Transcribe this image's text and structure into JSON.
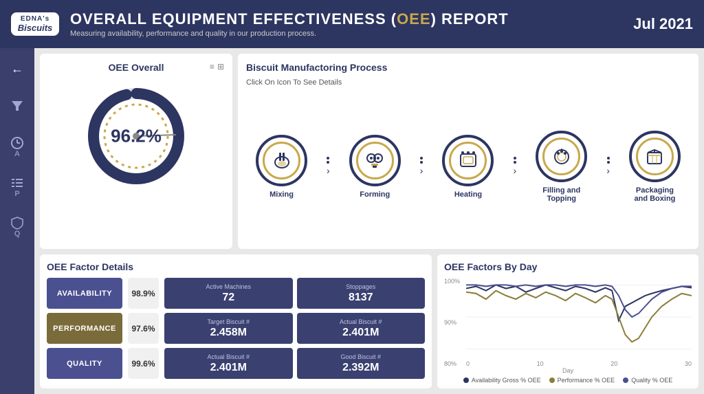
{
  "header": {
    "logo_edna": "EDNA's",
    "logo_biscuits": "Biscuits",
    "title_prefix": "OVERALL EQUIPMENT EFFECTIVENESS (",
    "title_oee": "OEE",
    "title_suffix": ") REPORT",
    "subtitle": "Measuring availability, performance and quality in our production process.",
    "date": "Jul 2021"
  },
  "sidebar": {
    "icons": [
      {
        "name": "back-icon",
        "symbol": "←",
        "label": ""
      },
      {
        "name": "filter-icon",
        "symbol": "▼",
        "label": ""
      },
      {
        "name": "clock-icon",
        "symbol": "⏱",
        "label": "A"
      },
      {
        "name": "list-icon",
        "symbol": "≡",
        "label": "P"
      },
      {
        "name": "shield-icon",
        "symbol": "🛡",
        "label": "Q"
      }
    ]
  },
  "oee_overall": {
    "title": "OEE Overall",
    "value": "96.2%",
    "donut_percent": 96.2,
    "donut_color": "#2d3561",
    "donut_track": "#e0e0e0"
  },
  "process": {
    "title": "Biscuit Manufactoring Process",
    "instruction": "Click On Icon To See Details",
    "steps": [
      {
        "label": "Mixing",
        "icon": "🍶"
      },
      {
        "label": "Forming",
        "icon": "⚙"
      },
      {
        "label": "Heating",
        "icon": "🍪"
      },
      {
        "label": "Filling and\nTopping",
        "icon": "🧁"
      },
      {
        "label": "Packaging\nand Boxing",
        "icon": "📦"
      }
    ]
  },
  "oee_factors": {
    "title": "OEE Factor Details",
    "rows": [
      {
        "name": "AVAILABILITY",
        "color": "#4a5090",
        "pct": "98.9%",
        "cells": [
          {
            "label": "Active Machines",
            "value": "72"
          },
          {
            "label": "Stoppages",
            "value": "8137"
          }
        ]
      },
      {
        "name": "PERFORMANCE",
        "color": "#7a6b3a",
        "pct": "97.6%",
        "cells": [
          {
            "label": "Target Biscuit #",
            "value": "2.458M"
          },
          {
            "label": "Actual Biscuit #",
            "value": "2.401M"
          }
        ]
      },
      {
        "name": "QUALITY",
        "color": "#4a5090",
        "pct": "99.6%",
        "cells": [
          {
            "label": "Actual Biscuit #",
            "value": "2.401M"
          },
          {
            "label": "Good Biscuit #",
            "value": "2.392M"
          }
        ]
      }
    ]
  },
  "oee_by_day": {
    "title": "OEE Factors By Day",
    "y_labels": [
      "100%",
      "90%",
      "80%"
    ],
    "x_labels": [
      "0",
      "10",
      "20",
      "30"
    ],
    "x_title": "Day",
    "legend": [
      {
        "label": "Availability Gross % OEE",
        "color": "#2d3561"
      },
      {
        "label": "Performance % OEE",
        "color": "#8b7d3a"
      },
      {
        "label": "Quality % OEE",
        "color": "#4a5090"
      }
    ]
  }
}
